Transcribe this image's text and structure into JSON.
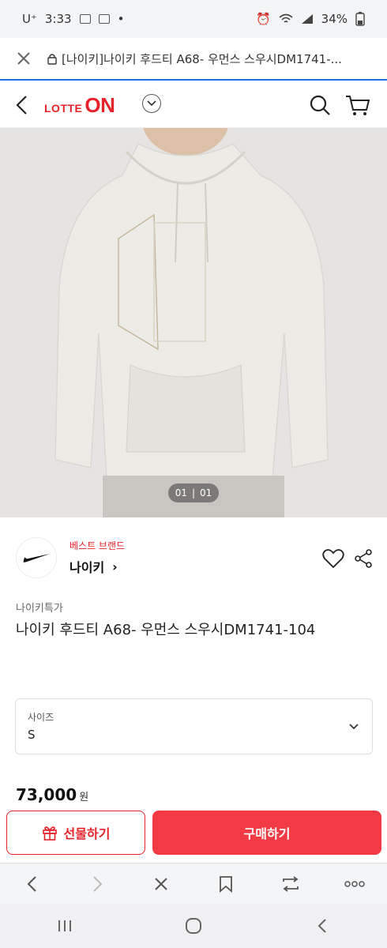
{
  "status_bar": {
    "carrier": "U⁺",
    "time": "3:33",
    "battery": "34%"
  },
  "url_bar": {
    "url_text": "[나이키]나이키 후드티 A68- 우먼스 스우시DM1741-..."
  },
  "header": {
    "logo_small": "LOTTE",
    "logo_big": "ON"
  },
  "gallery": {
    "counter_current": "01",
    "counter_total": "01"
  },
  "brand": {
    "tag": "베스트 브랜드",
    "name": "나이키",
    "name_arrow": "›"
  },
  "product": {
    "seller": "나이키특가",
    "title": "나이키 후드티 A68- 우먼스 스우시DM1741-104"
  },
  "option": {
    "label": "사이즈",
    "value": "S"
  },
  "price": {
    "amount": "73,000",
    "unit": "원"
  },
  "actions": {
    "gift_label": "선물하기",
    "buy_label": "구매하기"
  },
  "colors": {
    "accent": "#e6222a",
    "buy_button": "#f23a45",
    "url_underline": "#1a73e8"
  }
}
